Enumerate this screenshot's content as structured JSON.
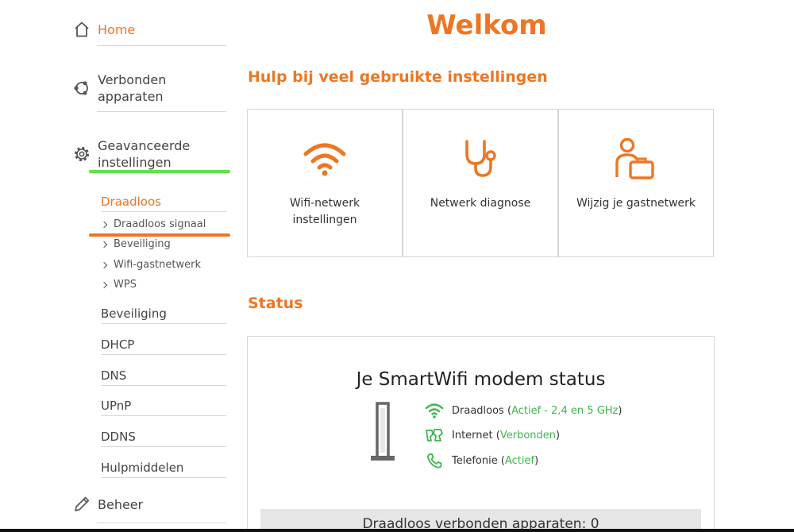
{
  "sidebar": {
    "home": "Home",
    "connected_devices": [
      "Verbonden",
      "apparaten"
    ],
    "advanced": [
      "Geavanceerde",
      "instellingen"
    ],
    "wireless_header": "Draadloos",
    "wireless_items": [
      "Draadloos signaal",
      "Beveiliging",
      "Wifi-gastnetwerk",
      "WPS"
    ],
    "sections": [
      "Beveiliging",
      "DHCP",
      "DNS",
      "UPnP",
      "DDNS",
      "Hulpmiddelen"
    ],
    "beheer": "Beheer"
  },
  "main": {
    "title": "Welkom",
    "help_title": "Hulp bij veel gebruikte instellingen",
    "cards": [
      {
        "label": "Wifi-netwerk instellingen",
        "icon": "wifi-icon"
      },
      {
        "label": "Netwerk diagnose",
        "icon": "stethoscope-icon"
      },
      {
        "label": "Wijzig je gastnetwerk",
        "icon": "guest-icon"
      }
    ],
    "status_title": "Status",
    "status": {
      "heading": "Je SmartWifi modem status",
      "rows": [
        {
          "label": "Draadloos",
          "value": "Actief - 2,4 en 5 GHz"
        },
        {
          "label": "Internet",
          "value": "Verbonden"
        },
        {
          "label": "Telefonie",
          "value": "Actief"
        }
      ],
      "devices": "Draadloos verbonden apparaten: 0"
    }
  },
  "colors": {
    "accent": "#ee7623",
    "active": "#66e04a",
    "status_green": "#3db64e"
  }
}
